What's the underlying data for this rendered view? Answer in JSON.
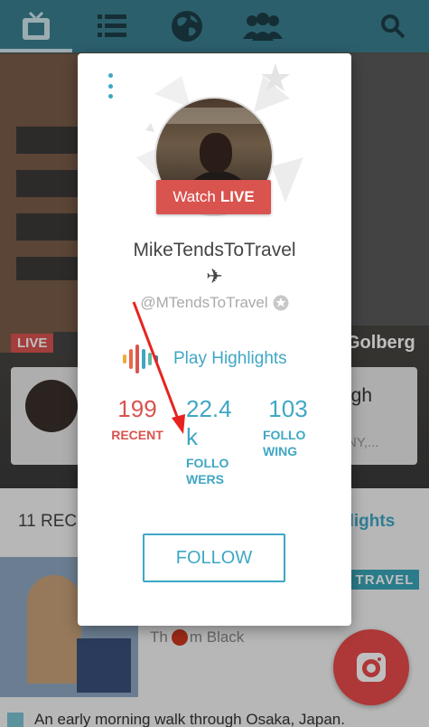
{
  "nav": {
    "items": [
      {
        "name": "tv-icon",
        "active": true
      },
      {
        "name": "list-icon",
        "active": false
      },
      {
        "name": "globe-icon",
        "active": false
      },
      {
        "name": "people-icon",
        "active": false
      },
      {
        "name": "search-icon",
        "active": false
      }
    ]
  },
  "background": {
    "live_label": "LIVE",
    "broadcaster_name_partial": "Golberg",
    "card_title_partial": "igh",
    "card_dot": ".",
    "card_location_partial": "NY,...",
    "recent_partial": "11 REC",
    "highlights_partial": "hlights",
    "travel_tag": "TRAVEL",
    "author_prefix": "Th",
    "author_suffix": "m Black",
    "caption": "An early morning walk through Osaka, Japan."
  },
  "modal": {
    "watch_prefix": "Watch",
    "watch_live": "LIVE",
    "username": "MikeTendsToTravel",
    "plane_emoji": "✈",
    "handle": "@MTendsToTravel",
    "play_highlights": "Play Highlights",
    "stats": {
      "recent_value": "199",
      "recent_label": "RECENT",
      "followers_value_line1": "22.4",
      "followers_value_line2": "k",
      "followers_label_line1": "FOLLO",
      "followers_label_line2": "WERS",
      "following_value": "103",
      "following_label_line1": "FOLLO",
      "following_label_line2": "WING"
    },
    "follow_button": "FOLLOW"
  },
  "colors": {
    "nav_bg": "#3b7f90",
    "accent": "#3fa7c4",
    "live_red": "#d9534f",
    "fab_red": "#e84a4a"
  }
}
